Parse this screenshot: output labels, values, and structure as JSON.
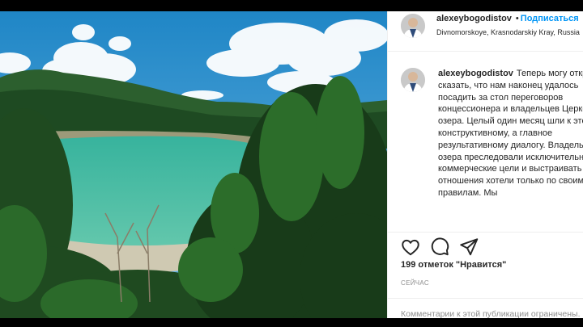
{
  "post": {
    "username": "alexeybogodistov",
    "separator": "•",
    "follow_label": "Подписаться",
    "location": "Divnomorskoye, Krasnodarskiy Kray, Russia",
    "caption_text": "Теперь могу открыто сказать, что нам наконец удалось посадить за стол переговоров концессионера и владельцев Церковного озера. Целый один месяц шли к этому конструктивному, а главное результативному диалогу. Владельцы озера преследовали исключительно коммерческие цели и выстраивать отношения хотели только по своим правилам. Мы",
    "likes": "199 отметок \"Нравится\"",
    "time": "СЕЙЧАС",
    "comment_placeholder": "Комментарии к этой публикации ограничены."
  },
  "icons": {
    "like": "heart-icon",
    "comment": "comment-icon",
    "share": "share-icon"
  },
  "colors": {
    "link": "#0095f6",
    "text": "#262626",
    "muted": "#8e8e8e",
    "lake": "#3fb9a0"
  }
}
